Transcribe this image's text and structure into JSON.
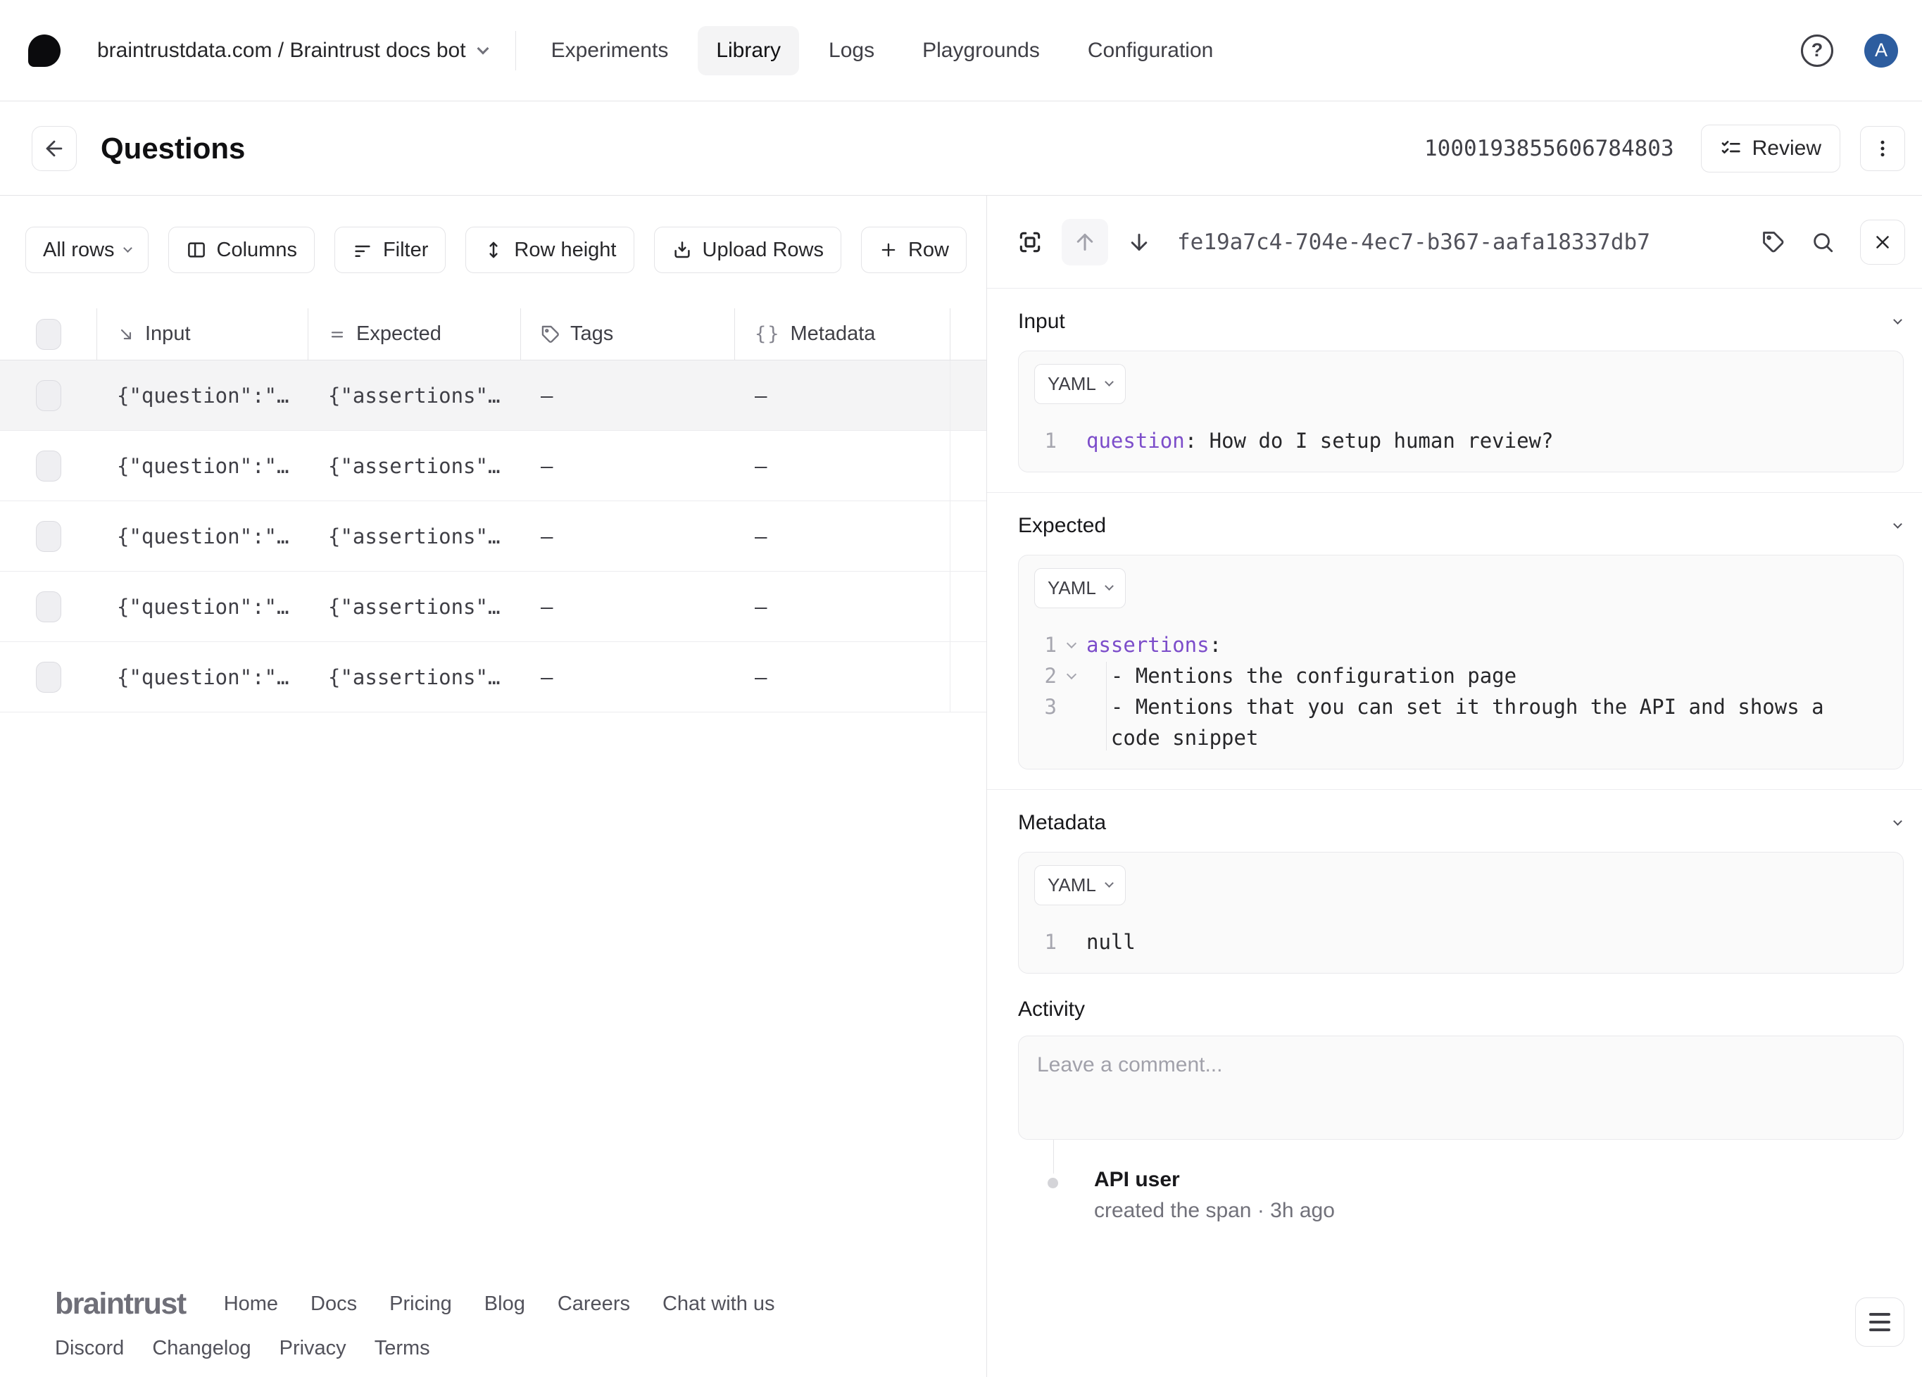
{
  "colors": {
    "accent_purple": "#7c4dca",
    "avatar_blue": "#2d5d9f",
    "selected_row_bg": "#f4f4f5",
    "border": "#e4e4e7"
  },
  "nav": {
    "breadcrumb": "braintrustdata.com / Braintrust docs bot",
    "items": [
      "Experiments",
      "Library",
      "Logs",
      "Playgrounds",
      "Configuration"
    ],
    "active_item": "Library",
    "avatar_initial": "A"
  },
  "header": {
    "title": "Questions",
    "dataset_id": "1000193855606784803",
    "review_label": "Review"
  },
  "toolbar": {
    "rows_filter_label": "All rows",
    "columns_label": "Columns",
    "filter_label": "Filter",
    "row_height_label": "Row height",
    "upload_rows_label": "Upload Rows",
    "add_row_label": "Row"
  },
  "table": {
    "columns": [
      {
        "label": "Input"
      },
      {
        "label": "Expected"
      },
      {
        "label": "Tags"
      },
      {
        "label": "Metadata"
      }
    ],
    "selected_row_index": 0,
    "rows": [
      {
        "input": "{\"question\":\"…",
        "expected": "{\"assertions\"…",
        "tags": "–",
        "metadata": "–"
      },
      {
        "input": "{\"question\":\"…",
        "expected": "{\"assertions\"…",
        "tags": "–",
        "metadata": "–"
      },
      {
        "input": "{\"question\":\"…",
        "expected": "{\"assertions\"…",
        "tags": "–",
        "metadata": "–"
      },
      {
        "input": "{\"question\":\"…",
        "expected": "{\"assertions\"…",
        "tags": "–",
        "metadata": "–"
      },
      {
        "input": "{\"question\":\"…",
        "expected": "{\"assertions\"…",
        "tags": "–",
        "metadata": "–"
      }
    ]
  },
  "panel": {
    "span_id": "fe19a7c4-704e-4ec7-b367-aafa18337db7",
    "sections": {
      "input": {
        "label": "Input",
        "format": "YAML",
        "lines": [
          {
            "num": "1",
            "fold": false,
            "segments": [
              {
                "t": "key",
                "s": "question"
              },
              {
                "t": "plain",
                "s": ": How do I setup human review?"
              }
            ]
          }
        ]
      },
      "expected": {
        "label": "Expected",
        "format": "YAML",
        "lines": [
          {
            "num": "1",
            "fold": true,
            "segments": [
              {
                "t": "key",
                "s": "assertions"
              },
              {
                "t": "plain",
                "s": ":"
              }
            ]
          },
          {
            "num": "2",
            "fold": true,
            "segments": [
              {
                "t": "plain",
                "s": "  - Mentions the configuration page"
              }
            ]
          },
          {
            "num": "3",
            "fold": false,
            "segments": [
              {
                "t": "plain",
                "s": "  - Mentions that you can set it through the API and shows a"
              }
            ]
          },
          {
            "num": "",
            "fold": false,
            "segments": [
              {
                "t": "plain",
                "s": "  code snippet"
              }
            ]
          }
        ]
      },
      "metadata": {
        "label": "Metadata",
        "format": "YAML",
        "lines": [
          {
            "num": "1",
            "fold": false,
            "segments": [
              {
                "t": "plain",
                "s": "null"
              }
            ]
          }
        ]
      }
    },
    "activity": {
      "heading": "Activity",
      "comment_placeholder": "Leave a comment...",
      "event_user": "API user",
      "event_description": "created the span · 3h ago"
    }
  },
  "footer": {
    "logo_text": "braintrust",
    "links_primary": [
      "Home",
      "Docs",
      "Pricing",
      "Blog",
      "Careers",
      "Chat with us"
    ],
    "links_secondary": [
      "Discord",
      "Changelog",
      "Privacy",
      "Terms"
    ]
  }
}
